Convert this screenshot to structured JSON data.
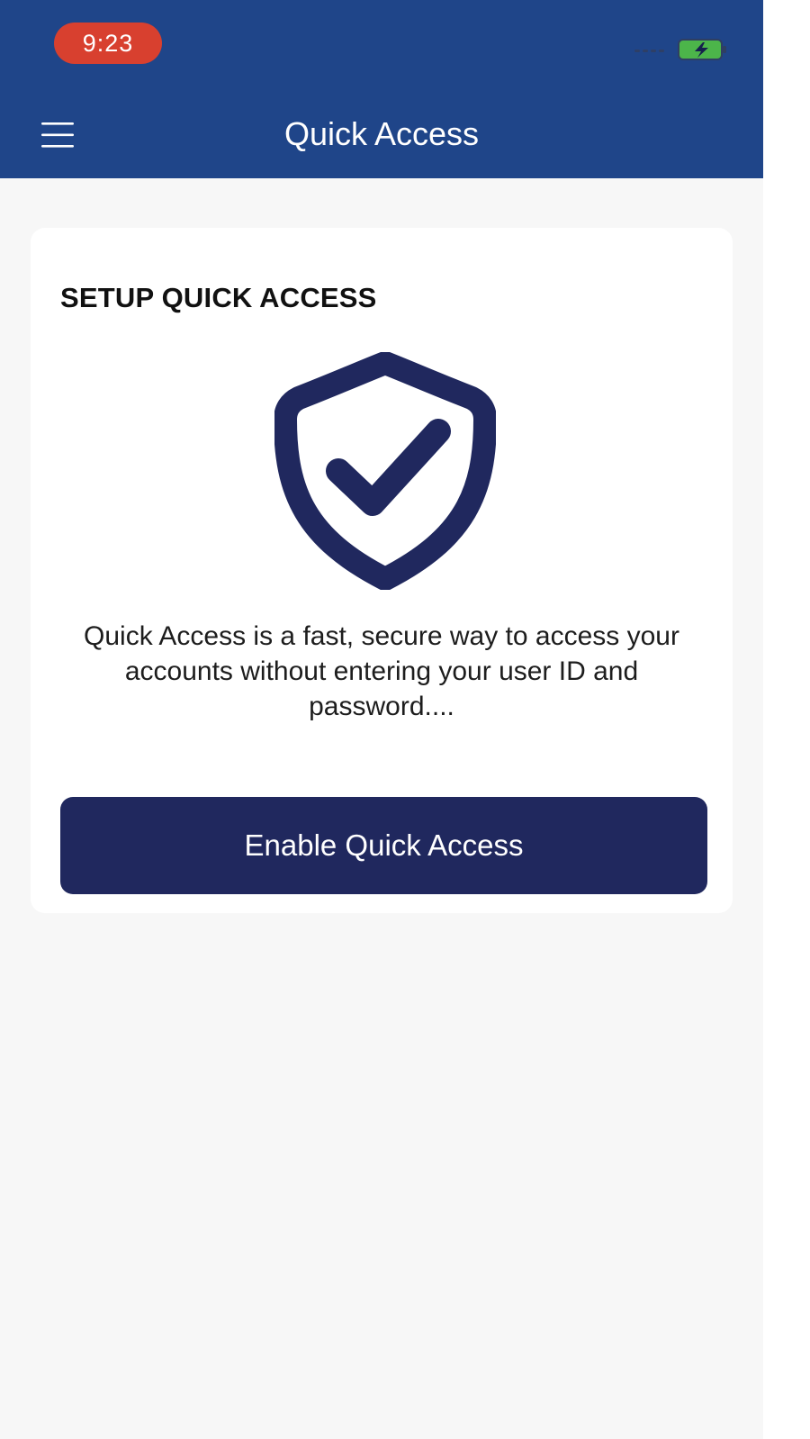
{
  "status_bar": {
    "time": "9:23",
    "battery_icon": "charging-battery-icon",
    "battery_color": "#4cb54a"
  },
  "header": {
    "title": "Quick Access",
    "menu_icon": "hamburger-menu-icon",
    "background_color": "#1f4589"
  },
  "card": {
    "title": "SETUP QUICK ACCESS",
    "icon": "shield-check-icon",
    "icon_color": "#20285e",
    "description": "Quick Access is a fast, secure way to access your accounts without entering your user ID and password....",
    "button_label": "Enable Quick Access",
    "button_color": "#20285e"
  }
}
